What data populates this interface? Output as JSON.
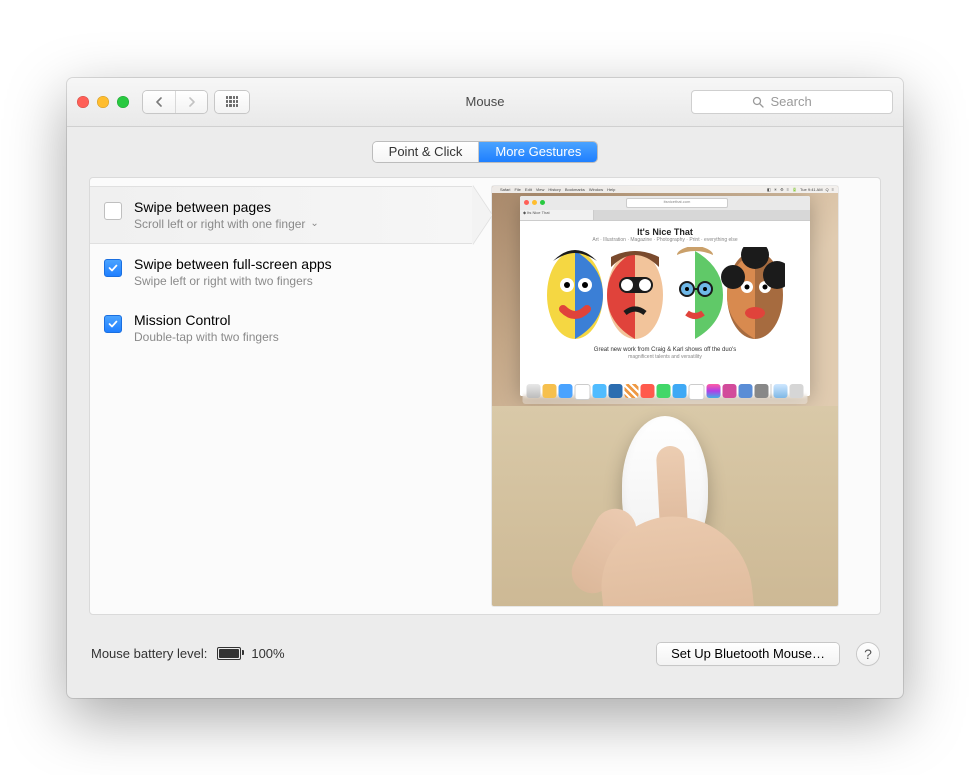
{
  "window": {
    "title": "Mouse",
    "search_placeholder": "Search"
  },
  "tabs": [
    {
      "label": "Point & Click",
      "active": false
    },
    {
      "label": "More Gestures",
      "active": true
    }
  ],
  "gestures": [
    {
      "title": "Swipe between pages",
      "desc": "Scroll left or right with one finger",
      "checked": false,
      "selected": true,
      "has_dropdown": true
    },
    {
      "title": "Swipe between full-screen apps",
      "desc": "Swipe left or right with two fingers",
      "checked": true,
      "selected": false,
      "has_dropdown": false
    },
    {
      "title": "Mission Control",
      "desc": "Double-tap with two fingers",
      "checked": true,
      "selected": false,
      "has_dropdown": false
    }
  ],
  "preview": {
    "headline": "It's Nice That",
    "caption_line1": "Great new work from Craig & Karl shows off the duo's",
    "caption_line2": "magnificent talents and versatility"
  },
  "footer": {
    "battery_label": "Mouse battery level:",
    "battery_pct": "100%",
    "setup_button": "Set Up Bluetooth Mouse…",
    "help": "?"
  }
}
